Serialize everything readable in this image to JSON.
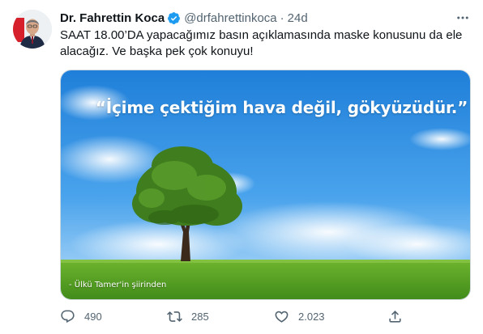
{
  "tweet": {
    "author": {
      "display_name": "Dr. Fahrettin Koca",
      "handle": "@drfahrettinkoca",
      "verified_icon": "verified-badge-icon",
      "avatar_icon": "profile-photo"
    },
    "separator": "·",
    "time": "24d",
    "more_icon": "more-horizontal-icon",
    "text_lines": [
      "SAAT 18.00’DA yapacağımız basın açıklamasında maske konusunu da ele",
      "alacağız. Ve başka pek çok konuyu!"
    ],
    "media": {
      "quote": "“İçime çektiğim hava değil, gökyüzüdür.”",
      "caption": "- Ülkü Tamer'in şiirinden"
    },
    "actions": {
      "reply": {
        "icon": "reply-icon",
        "count": "490"
      },
      "retweet": {
        "icon": "retweet-icon",
        "count": "285"
      },
      "like": {
        "icon": "like-heart-icon",
        "count": "2.023"
      },
      "share": {
        "icon": "share-icon"
      }
    }
  },
  "colors": {
    "text": "#0f1419",
    "secondary": "#536471",
    "verified": "#1d9bf0",
    "sky": "#2a8be0",
    "grass": "#4f9a22"
  }
}
